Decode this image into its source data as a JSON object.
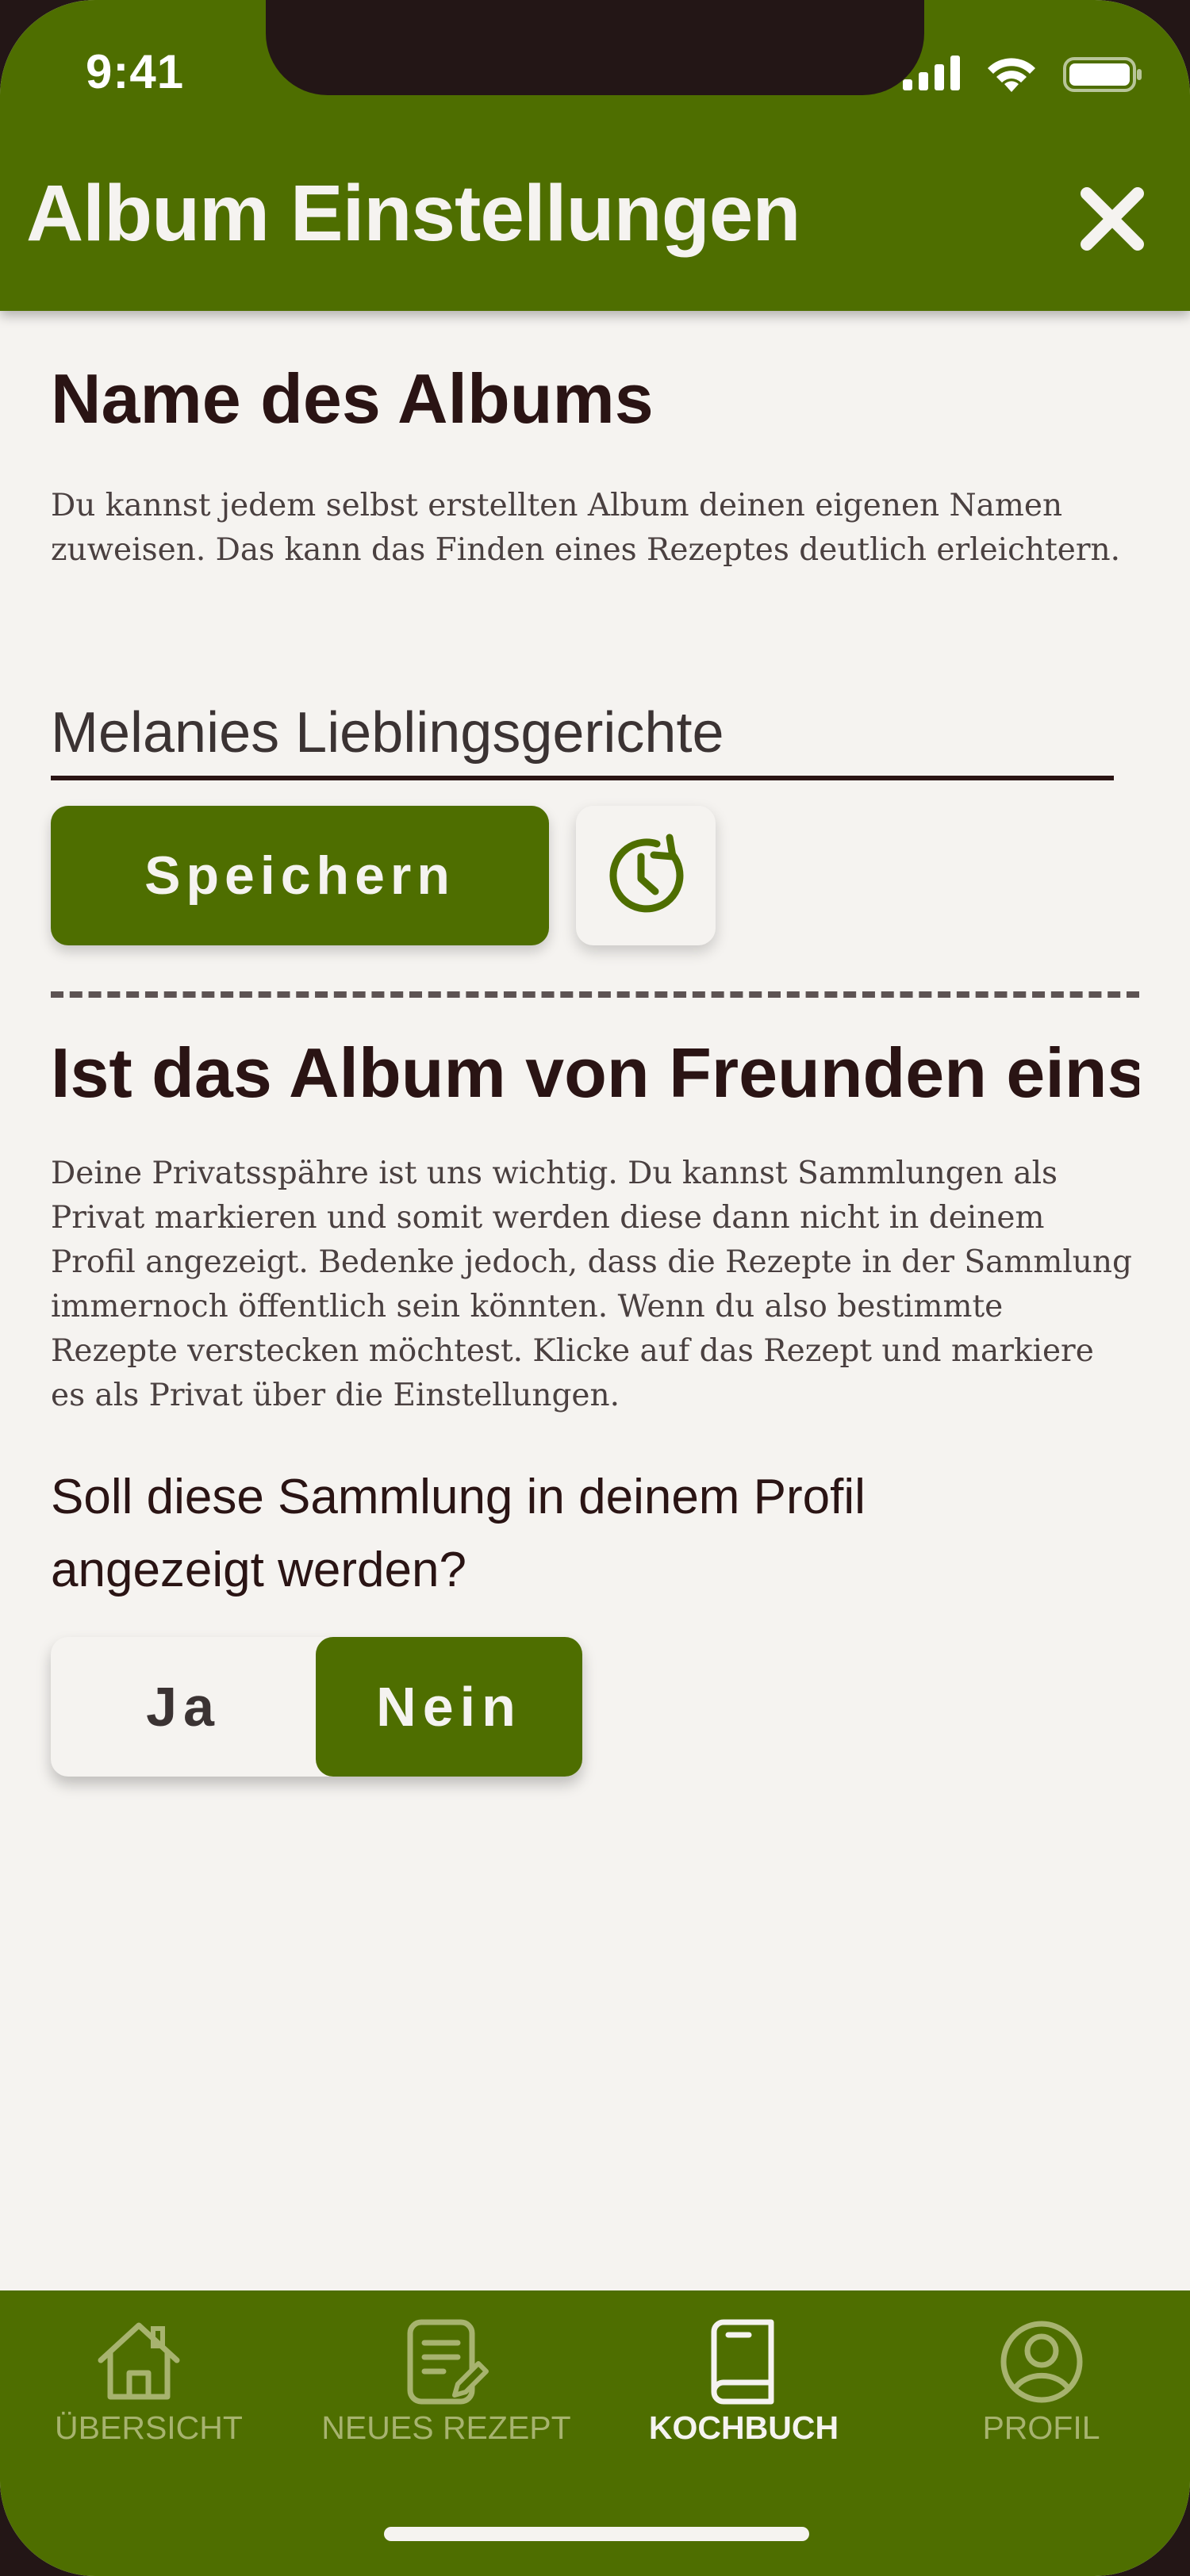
{
  "status_bar": {
    "time": "9:41"
  },
  "header": {
    "title": "Album Einstellungen"
  },
  "album_name": {
    "heading": "Name des Albums",
    "description": "Du kannst jedem selbst erstellten Album deinen eigenen Namen zuweisen. Das kann das Finden eines Rezeptes deutlich erleichtern.",
    "input_value": "Melanies Lieblingsgerichte",
    "save_label": "Speichern"
  },
  "visibility": {
    "heading": "Ist das Album von Freunden einse",
    "description": "Deine Privatsspähre ist uns wichtig. Du kannst Sammlungen als Privat markieren und somit werden diese dann nicht in deinem Profil angezeigt. Bedenke jedoch, dass die Rezepte in der Sammlung immernoch öffentlich sein könnten. Wenn du also bestimmte Rezepte verstecken möchtest. Klicke auf das Rezept und markiere es als Privat über die Einstellungen.",
    "question": "Soll diese Sammlung in deinem Profil angezeigt werden?",
    "options": [
      "Ja",
      "Nein"
    ],
    "selected": "Nein"
  },
  "tabbar": {
    "items": [
      {
        "label": "ÜBERSICHT",
        "icon": "house-icon",
        "active": false
      },
      {
        "label": "NEUES REZEPT",
        "icon": "note-pen-icon",
        "active": false
      },
      {
        "label": "KOCHBUCH",
        "icon": "book-icon",
        "active": true
      },
      {
        "label": "PROFIL",
        "icon": "user-circle-icon",
        "active": false
      }
    ]
  },
  "colors": {
    "brand_green": "#4e6e00",
    "background": "#f5f3f0",
    "text_dark": "#2a1414",
    "inactive_tab": "#a7b36f"
  }
}
